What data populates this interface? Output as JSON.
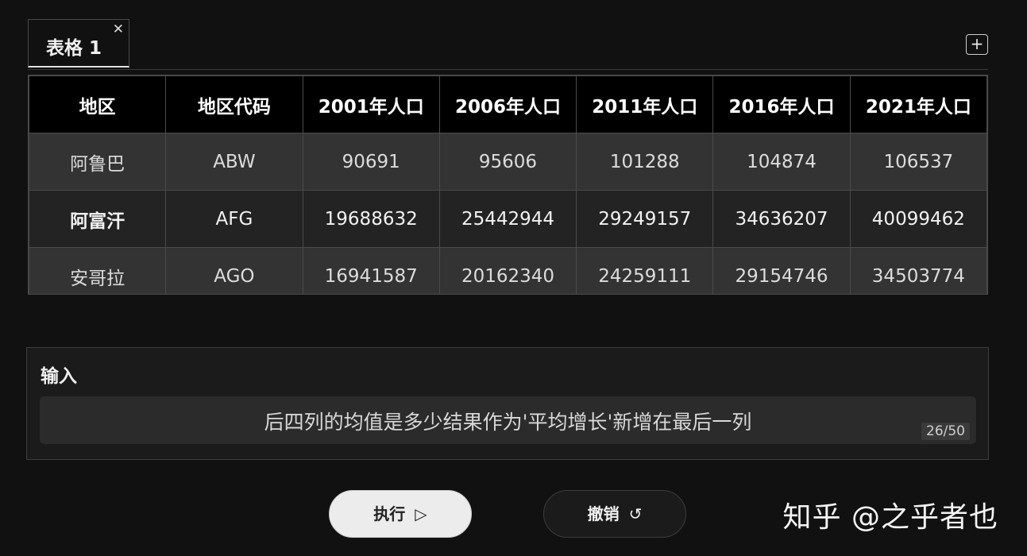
{
  "tabs": [
    {
      "label": "表格 1",
      "close_icon": "close-icon"
    }
  ],
  "add_tab_icon": "+",
  "table": {
    "headers": [
      "地区",
      "地区代码",
      "2001年人口",
      "2006年人口",
      "2011年人口",
      "2016年人口",
      "2021年人口"
    ],
    "rows": [
      [
        "阿鲁巴",
        "ABW",
        "90691",
        "95606",
        "101288",
        "104874",
        "106537"
      ],
      [
        "阿富汗",
        "AFG",
        "19688632",
        "25442944",
        "29249157",
        "34636207",
        "40099462"
      ],
      [
        "安哥拉",
        "AGO",
        "16941587",
        "20162340",
        "24259111",
        "29154746",
        "34503774"
      ]
    ]
  },
  "input": {
    "label": "输入",
    "value": "后四列的均值是多少结果作为'平均增长'新增在最后一列",
    "counter": "26/50"
  },
  "buttons": {
    "run_label": "执行",
    "run_icon": "▷",
    "undo_label": "撤销",
    "undo_icon": "↺"
  },
  "watermark": "知乎 @之乎者也",
  "colors": {
    "background": "#111111",
    "header_bg": "#000000",
    "row_odd_bg": "#333333",
    "row_even_bg": "#232323",
    "run_button_bg": "#ececec"
  }
}
